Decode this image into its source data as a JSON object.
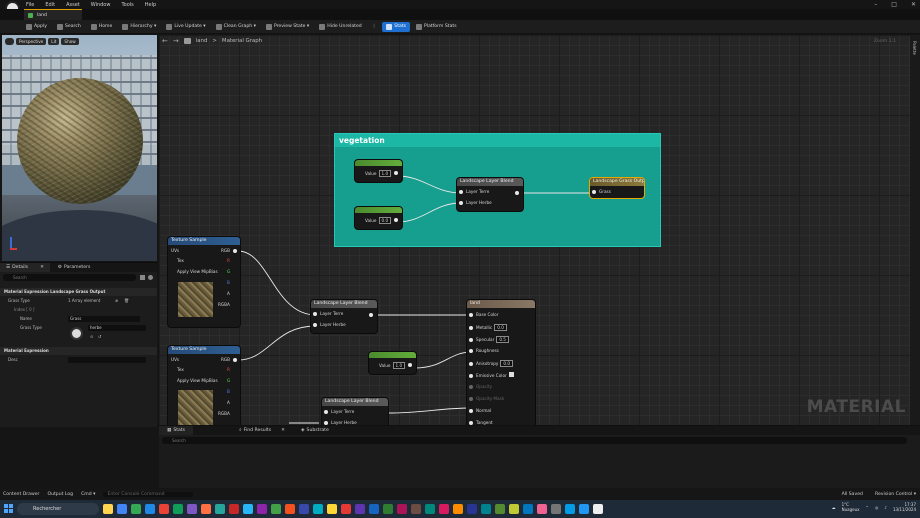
{
  "menu": [
    "File",
    "Edit",
    "Asset",
    "Window",
    "Tools",
    "Help"
  ],
  "tab": {
    "label": "land"
  },
  "toolbar": {
    "items": [
      {
        "label": "Apply",
        "icon": "apply-icon"
      },
      {
        "label": "Search",
        "icon": "search-icon"
      },
      {
        "label": "Home",
        "icon": "home-icon"
      },
      {
        "label": "Hierarchy ▾",
        "icon": "hierarchy-icon"
      },
      {
        "label": "Live Update ▾",
        "icon": "live-update-icon"
      },
      {
        "label": "Clean Graph ▾",
        "icon": "clean-graph-icon"
      },
      {
        "label": "Preview State ▾",
        "icon": "preview-state-icon"
      },
      {
        "label": "Hide Unrelated",
        "icon": "hide-unrelated-icon"
      },
      {
        "label": "Stats",
        "icon": "stats-icon",
        "active": true
      },
      {
        "label": "Platform Stats",
        "icon": "platform-stats-icon"
      }
    ]
  },
  "viewport": {
    "buttons": [
      "Perspective",
      "Lit",
      "Show"
    ]
  },
  "details": {
    "tabs": [
      "Details",
      "Parameters"
    ],
    "search_placeholder": "Search",
    "section": "Material Expression Landscape Grass Output",
    "grass_type_label": "Grass Type",
    "grass_type_value": "1 Array element",
    "item_label": "Index [ 0 ]",
    "name_label": "Name",
    "name_value": "Grass",
    "grass_type2_label": "Grass Type",
    "grass_type2_value": "herbe",
    "section2": "Material Expression",
    "desc_label": "Desc"
  },
  "graph": {
    "breadcrumb": {
      "asset": "land",
      "graph": "Material Graph"
    },
    "zoom": "Zoom 1:1",
    "watermark": "MATERIAL",
    "palette": "Palette",
    "comment": "vegetation",
    "nodes": {
      "param1": {
        "value_label": "Value",
        "value": "1.0"
      },
      "param2": {
        "value_label": "Value",
        "value": "0.0"
      },
      "blend_top": {
        "title": "Landscape Layer Blend",
        "pin1": "Layer Terre",
        "pin2": "Layer Herbe"
      },
      "grass_output": {
        "title": "Landscape Grass Output",
        "pin": "Grass"
      },
      "tex1": {
        "title": "Texture Sample",
        "uvs": "UVs",
        "tex": "Tex",
        "apply": "Apply View MipBias",
        "rgb": "RGB",
        "r": "R",
        "g": "G",
        "b": "B",
        "a": "A",
        "rgba": "RGBA"
      },
      "tex2": {
        "title": "Texture Sample",
        "uvs": "UVs",
        "tex": "Tex",
        "apply": "Apply View MipBias",
        "rgb": "RGB",
        "r": "R",
        "g": "G",
        "b": "B",
        "a": "A",
        "rgba": "RGBA"
      },
      "blend_mid": {
        "title": "Landscape Layer Blend",
        "pin1": "Layer Terre",
        "pin2": "Layer Herbe"
      },
      "blend_low": {
        "title": "Landscape Layer Blend",
        "pin1": "Layer Terre",
        "pin2": "Layer Herbe"
      },
      "param3": {
        "value_label": "Value",
        "value": "1.0"
      },
      "result": {
        "title": "land",
        "pins": [
          "Base Color",
          "Metallic",
          "Specular",
          "Roughness",
          "Anisotropy",
          "Emissive Color",
          "Opacity",
          "Opacity Mask",
          "Normal",
          "Tangent"
        ],
        "metallic": "0.0",
        "specular": "0.5",
        "anisotropy": "0.0"
      }
    }
  },
  "bottom": {
    "tabs": [
      "Stats",
      "Find Results",
      "Substrate"
    ],
    "search_placeholder": "Search"
  },
  "statusbar": {
    "left": [
      "Content Drawer",
      "Output Log",
      "Cmd ▾"
    ],
    "cmd_placeholder": "Enter Console Command",
    "right": [
      "All Saved",
      "Revision Control ▾"
    ]
  },
  "taskbar": {
    "search": "Rechercher",
    "weather": "1°C",
    "weather_desc": "Nuageux",
    "time": "17:37",
    "date": "13/11/2024"
  }
}
